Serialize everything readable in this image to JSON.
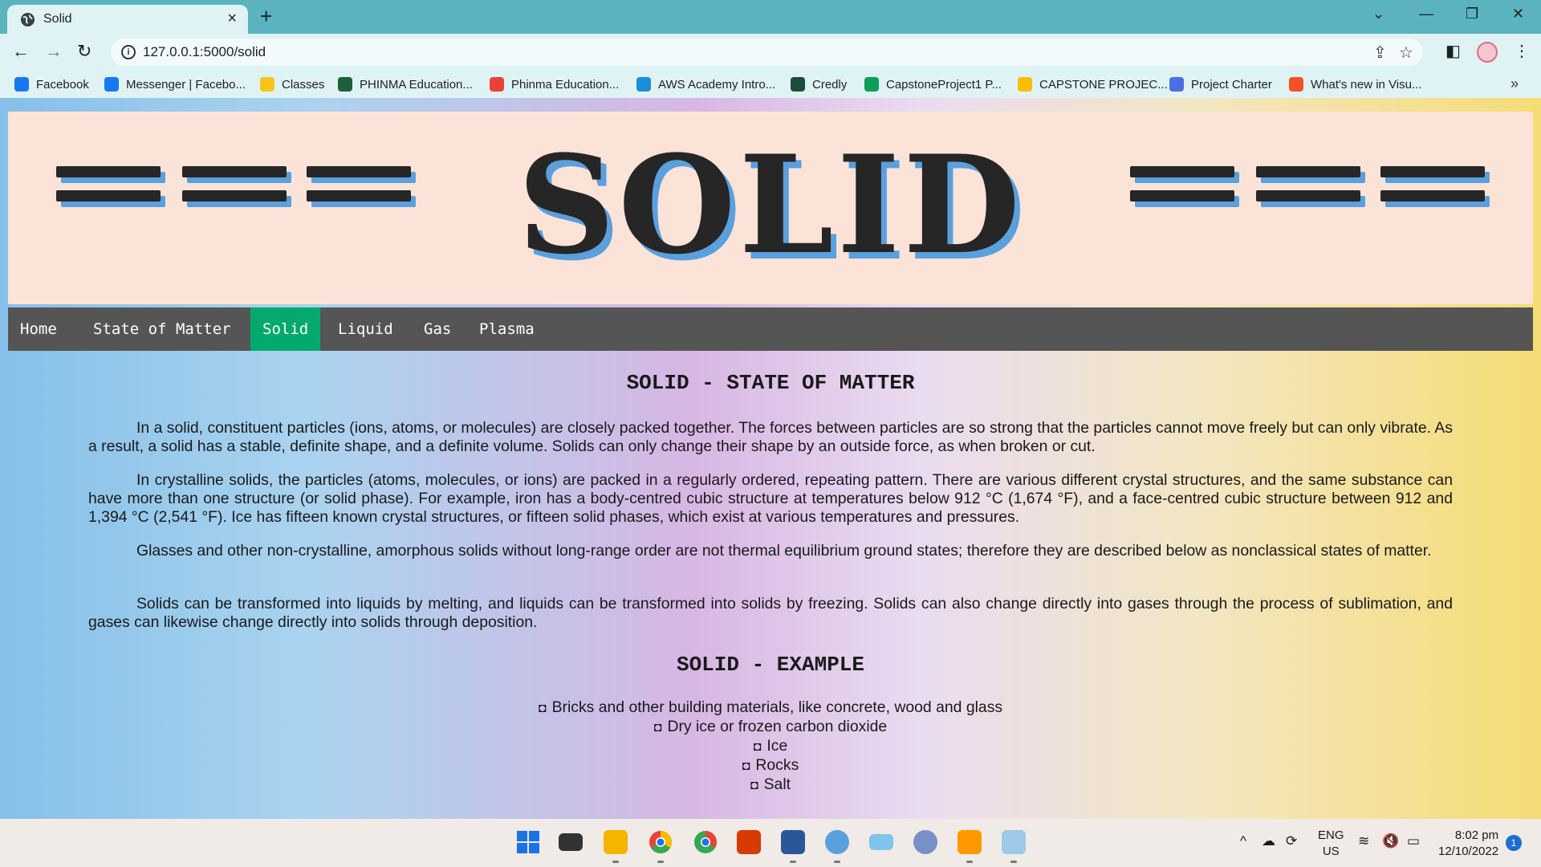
{
  "browser": {
    "tab_title": "Solid",
    "tab_close": "×",
    "new_tab": "+",
    "url": "127.0.0.1:5000/solid",
    "bookmarks": [
      {
        "label": "Facebook",
        "color": "#1877f2"
      },
      {
        "label": "Messenger | Facebo...",
        "color": "#1877f2"
      },
      {
        "label": "Classes",
        "color": "#f5c518"
      },
      {
        "label": "PHINMA Education...",
        "color": "#1e5f3a"
      },
      {
        "label": "Phinma Education...",
        "color": "#ea4335"
      },
      {
        "label": "AWS Academy Intro...",
        "color": "#1a8ddb"
      },
      {
        "label": "Credly",
        "color": "#1d4d3a"
      },
      {
        "label": "CapstoneProject1 P...",
        "color": "#0f9d58"
      },
      {
        "label": "CAPSTONE PROJEC...",
        "color": "#fbbc04"
      },
      {
        "label": "Project Charter",
        "color": "#4a6fe3"
      },
      {
        "label": "What's new in Visu...",
        "color": "#f35325"
      }
    ],
    "bookmarks_more": "»"
  },
  "page": {
    "banner_title": "SOLID",
    "nav": [
      "Home",
      "State of Matter",
      "Solid",
      "Liquid",
      "Gas",
      "Plasma"
    ],
    "active_nav": "Solid",
    "heading": "SOLID - STATE OF MATTER",
    "paragraphs": [
      "In a solid, constituent particles (ions, atoms, or molecules) are closely packed together. The forces between particles are so strong that the particles cannot move freely but can only vibrate. As a result, a solid has a stable, definite shape, and a definite volume. Solids can only change their shape by an outside force, as when broken or cut.",
      "In crystalline solids, the particles (atoms, molecules, or ions) are packed in a regularly ordered, repeating pattern. There are various different crystal structures, and the same substance can have more than one structure (or solid phase). For example, iron has a body-centred cubic structure at temperatures below 912 °C (1,674 °F), and a face-centred cubic structure between 912 and 1,394 °C (2,541 °F). Ice has fifteen known crystal structures, or fifteen solid phases, which exist at various temperatures and pressures.",
      "Glasses and other non-crystalline, amorphous solids without long-range order are not thermal equilibrium ground states; therefore they are described below as nonclassical states of matter.",
      "Solids can be transformed into liquids by melting, and liquids can be transformed into solids by freezing. Solids can also change directly into gases through the process of sublimation, and gases can likewise change directly into solids through deposition."
    ],
    "example_heading": "SOLID - EXAMPLE",
    "examples": [
      "Bricks and other building materials, like concrete, wood and glass",
      "Dry ice or frozen carbon dioxide",
      "Ice",
      "Rocks",
      "Salt"
    ]
  },
  "taskbar": {
    "lang_top": "ENG",
    "lang_bottom": "US",
    "time": "8:02 pm",
    "date": "12/10/2022",
    "notification_count": "1"
  }
}
